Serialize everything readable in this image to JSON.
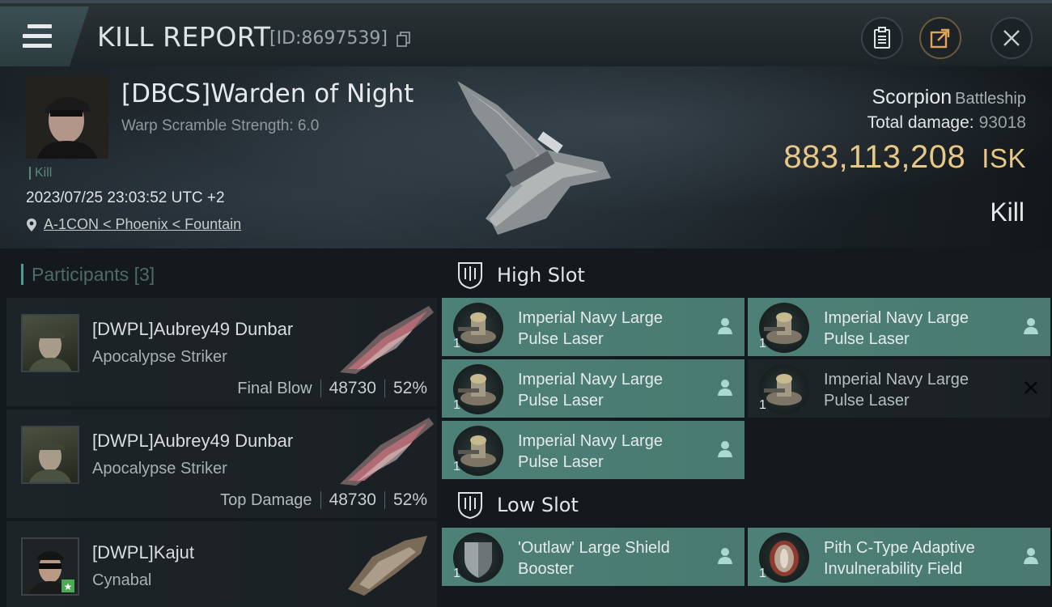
{
  "header": {
    "title": "KILL REPORT",
    "report_id": "[ID:8697539]"
  },
  "victim": {
    "name": "[DBCS]Warden of Night",
    "warp_scramble": "Warp Scramble Strength: 6.0",
    "tag": "Kill",
    "datetime": "2023/07/25 23:03:52 UTC +2",
    "location": "A-1CON < Phoenix < Fountain",
    "ship_name": "Scorpion",
    "ship_class": "Battleship",
    "total_damage_label": "Total damage:",
    "total_damage": "93018",
    "isk_value": "883,113,208",
    "isk_unit": "ISK",
    "status": "Kill"
  },
  "participants": {
    "title": "Participants",
    "count": "[3]",
    "items": [
      {
        "name": "[DWPL]Aubrey49 Dunbar",
        "ship": "Apocalypse Striker",
        "label": "Final Blow",
        "damage": "48730",
        "percent": "52%"
      },
      {
        "name": "[DWPL]Aubrey49 Dunbar",
        "ship": "Apocalypse Striker",
        "label": "Top Damage",
        "damage": "48730",
        "percent": "52%"
      },
      {
        "name": "[DWPL]Kajut",
        "ship": "Cynabal",
        "label": "",
        "damage": "",
        "percent": ""
      }
    ]
  },
  "high_slot": {
    "title": "High Slot",
    "modules": [
      {
        "line1": "Imperial Navy Large",
        "line2": "Pulse Laser",
        "qty": "1"
      },
      {
        "line1": "Imperial Navy Large",
        "line2": "Pulse Laser",
        "qty": "1"
      },
      {
        "line1": "Imperial Navy Large",
        "line2": "Pulse Laser",
        "qty": "1"
      },
      {
        "line1": "Imperial Navy Large",
        "line2": "Pulse Laser",
        "qty": "1"
      },
      {
        "line1": "Imperial Navy Large",
        "line2": "Pulse Laser",
        "qty": "1"
      }
    ]
  },
  "low_slot": {
    "title": "Low Slot",
    "modules": [
      {
        "line1": "'Outlaw' Large Shield",
        "line2": "Booster",
        "qty": "1"
      },
      {
        "line1": "Pith C-Type Adaptive",
        "line2": "Invulnerability Field",
        "qty": "1"
      }
    ]
  },
  "colors": {
    "accent_teal": "#4d8076",
    "isk_gold": "#e8c886"
  }
}
